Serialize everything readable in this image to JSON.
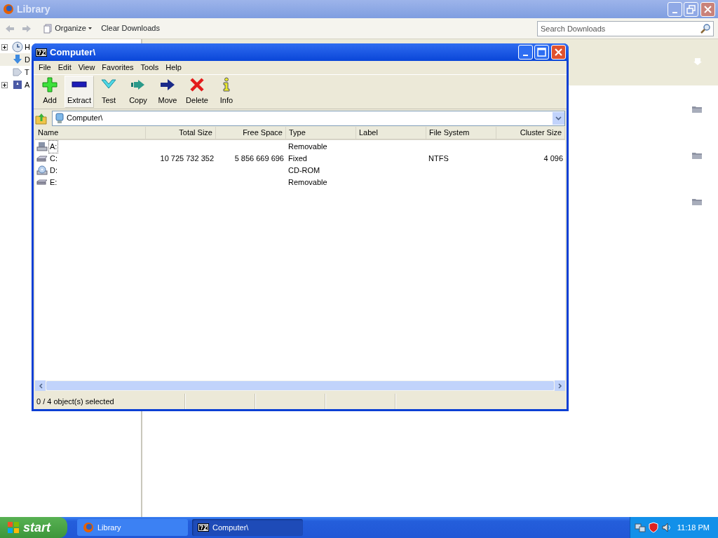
{
  "library": {
    "title": "Library",
    "toolbar": {
      "organize": "Organize",
      "clear": "Clear Downloads"
    },
    "search": {
      "placeholder": "Search Downloads"
    },
    "sidebar": [
      {
        "label": "H",
        "kind": "history",
        "expanded": false,
        "selected": false
      },
      {
        "label": "D",
        "kind": "downloads",
        "selected": true
      },
      {
        "label": "T",
        "kind": "tags",
        "selected": false
      },
      {
        "label": "A",
        "kind": "bookmarks",
        "expanded": false,
        "selected": false
      }
    ]
  },
  "sevenzip": {
    "title": "Computer\\",
    "menu": [
      "File",
      "Edit",
      "View",
      "Favorites",
      "Tools",
      "Help"
    ],
    "toolbar": [
      {
        "label": "Add",
        "kind": "add",
        "hovered": false
      },
      {
        "label": "Extract",
        "kind": "extract",
        "hovered": true
      },
      {
        "label": "Test",
        "kind": "test",
        "hovered": false
      },
      {
        "label": "Copy",
        "kind": "copy",
        "hovered": false
      },
      {
        "label": "Move",
        "kind": "move",
        "hovered": false
      },
      {
        "label": "Delete",
        "kind": "delete",
        "hovered": false
      },
      {
        "label": "Info",
        "kind": "info",
        "hovered": false
      }
    ],
    "address": "Computer\\",
    "columns": [
      {
        "label": "Name",
        "kind": "text"
      },
      {
        "label": "Total Size",
        "kind": "number"
      },
      {
        "label": "Free Space",
        "kind": "number"
      },
      {
        "label": "Type",
        "kind": "text"
      },
      {
        "label": "Label",
        "kind": "text"
      },
      {
        "label": "File System",
        "kind": "text"
      },
      {
        "label": "Cluster Size",
        "kind": "number"
      }
    ],
    "rows": [
      {
        "kind": "floppy",
        "focused": true,
        "cells": [
          "A:",
          null,
          null,
          "Removable",
          null,
          null,
          null
        ]
      },
      {
        "kind": "hdd",
        "focused": false,
        "cells": [
          "C:",
          "10 725 732 352",
          "5 856 669 696",
          "Fixed",
          null,
          "NTFS",
          "4 096"
        ]
      },
      {
        "kind": "cdrom",
        "focused": false,
        "cells": [
          "D:",
          null,
          null,
          "CD-ROM",
          null,
          null,
          null
        ]
      },
      {
        "kind": "removable",
        "focused": false,
        "cells": [
          "E:",
          null,
          null,
          "Removable",
          null,
          null,
          null
        ]
      }
    ],
    "status": "0 / 4 object(s) selected"
  },
  "taskbar": {
    "start": "start",
    "tasks": [
      {
        "label": "Library",
        "kind": "firefox",
        "selected": false
      },
      {
        "label": "Computer\\",
        "kind": "sevenzip",
        "selected": true
      }
    ],
    "clock": "11:18 PM"
  }
}
